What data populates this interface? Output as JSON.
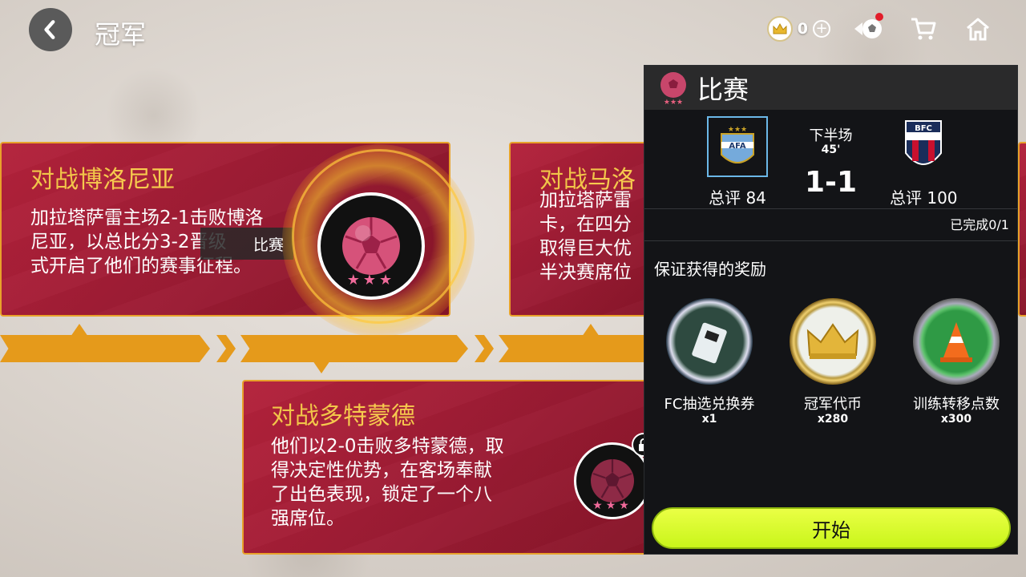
{
  "header": {
    "title": "冠军",
    "coin_value": "0",
    "icons": [
      "back-chevron-icon",
      "crown-coin-icon",
      "plus-icon",
      "ball-shop-icon",
      "cart-icon",
      "home-icon"
    ],
    "notification_color": "#e21d2a"
  },
  "cards": [
    {
      "title": "对战博洛尼亚",
      "desc": [
        "加拉塔萨雷主场2-1击败博洛",
        "尼亚，以总比分3-2晋级",
        "式开启了他们的赛事征程。"
      ],
      "tag": "比赛",
      "state": "selected"
    },
    {
      "title": "对战马洛",
      "desc": [
        "加拉塔萨雷",
        "卡，在四分",
        "取得巨大优",
        "半决赛席位"
      ],
      "state": "partial"
    },
    {
      "title": "对战多特蒙德",
      "desc": [
        "他们以2-0击败多特蒙德，取",
        "得决定性优势，在客场奉献",
        "了出色表现，锁定了一个八",
        "强席位。"
      ],
      "state": "locked"
    }
  ],
  "panel": {
    "title": "比赛",
    "home_rating": "总评 84",
    "away_rating": "总评 100",
    "period": "下半场",
    "minute": "45'",
    "score": "1-1",
    "progress": "已完成0/1",
    "rewards_title": "保证获得的奖励",
    "rewards": [
      {
        "name": "FC抽选兑换券",
        "qty": "x1",
        "icon": "ticket-icon"
      },
      {
        "name": "冠军代币",
        "qty": "x280",
        "icon": "crown-icon"
      },
      {
        "name": "训练转移点数",
        "qty": "x300",
        "icon": "training-cone-icon"
      }
    ],
    "start_label": "开始"
  },
  "colors": {
    "card_red": "#9a1b33",
    "card_border": "#e8a12a",
    "title_gold": "#f6c94a",
    "timeline": "#e59a1b",
    "start_button": "#d6fa2a",
    "panel_bg": "#131417"
  }
}
